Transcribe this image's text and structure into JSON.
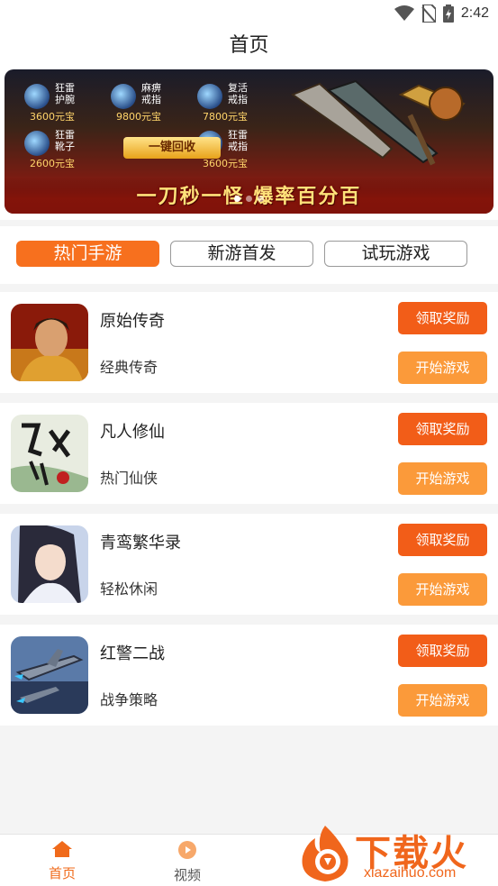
{
  "status_bar": {
    "time": "2:42",
    "icons": [
      "wifi-icon",
      "no-sim-icon",
      "battery-charging-icon"
    ]
  },
  "header": {
    "title": "首页"
  },
  "banner": {
    "items": [
      {
        "name": "狂雷护腕",
        "price": "3600元宝"
      },
      {
        "name": "麻痹戒指",
        "price": "9800元宝"
      },
      {
        "name": "复活戒指",
        "price": "7800元宝"
      },
      {
        "name": "狂雷靴子",
        "price": "2600元宝"
      },
      {
        "name": "狂雷戒指",
        "price": "3600元宝"
      }
    ],
    "recycle_label": "一键回收",
    "slogan": "一刀秒一怪 爆率百分百",
    "page_count": 3,
    "active_page": 1
  },
  "tabs": [
    {
      "label": "热门手游",
      "active": true
    },
    {
      "label": "新游首发",
      "active": false
    },
    {
      "label": "试玩游戏",
      "active": false
    }
  ],
  "games": [
    {
      "name": "原始传奇",
      "tag": "经典传奇",
      "reward_label": "领取奖励",
      "play_label": "开始游戏",
      "icon": "warrior-portrait-icon"
    },
    {
      "name": "凡人修仙",
      "tag": "热门仙侠",
      "reward_label": "领取奖励",
      "play_label": "开始游戏",
      "icon": "calligraphy-logo-icon"
    },
    {
      "name": "青鸾繁华录",
      "tag": "轻松休闲",
      "reward_label": "领取奖励",
      "play_label": "开始游戏",
      "icon": "anime-portrait-icon"
    },
    {
      "name": "红警二战",
      "tag": "战争策略",
      "reward_label": "领取奖励",
      "play_label": "开始游戏",
      "icon": "warplane-icon"
    }
  ],
  "bottom_nav": [
    {
      "label": "首页",
      "icon": "home-icon",
      "active": true
    },
    {
      "label": "视频",
      "icon": "play-circle-icon",
      "active": false
    }
  ],
  "watermark": {
    "brand": "下载火",
    "domain": "xiazaihuo.com"
  },
  "colors": {
    "accent": "#f7701e",
    "reward_button": "#f25d18",
    "play_button": "#fb9a3a"
  }
}
